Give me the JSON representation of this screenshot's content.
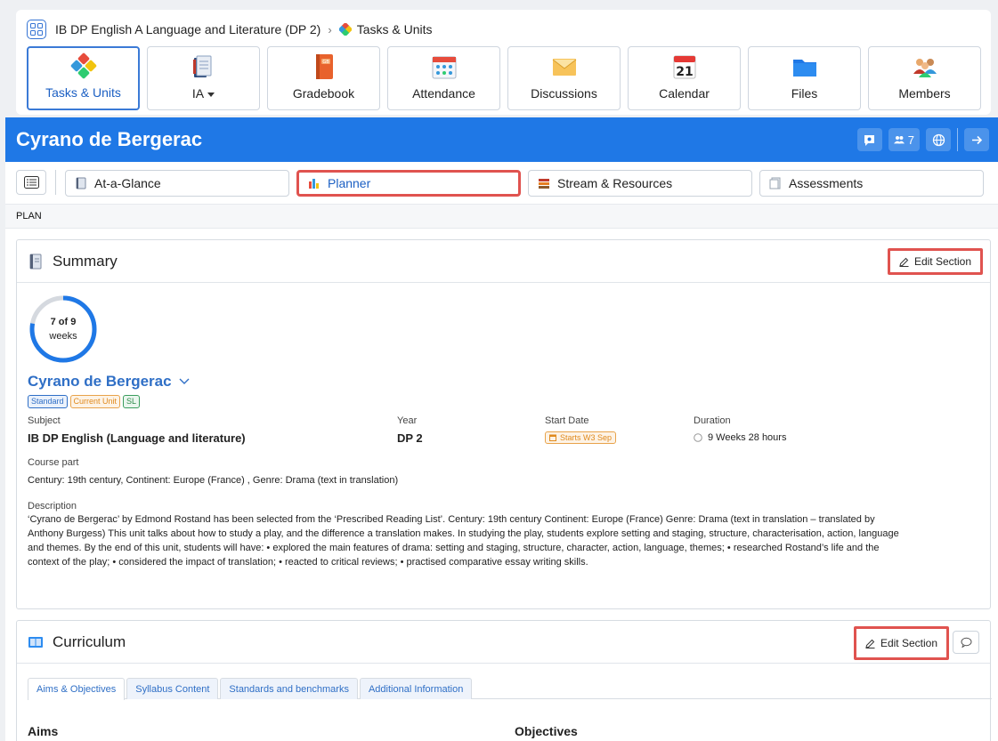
{
  "breadcrumb": {
    "course": "IB DP English A Language and Literature (DP 2)",
    "current": "Tasks & Units"
  },
  "nav_tabs": [
    {
      "label": "Tasks & Units",
      "icon": "puzzle-icon",
      "active": true
    },
    {
      "label": "IA",
      "icon": "books-icon",
      "dropdown": true
    },
    {
      "label": "Gradebook",
      "icon": "gradebook-icon"
    },
    {
      "label": "Attendance",
      "icon": "attendance-icon"
    },
    {
      "label": "Discussions",
      "icon": "envelope-icon"
    },
    {
      "label": "Calendar",
      "icon": "calendar-icon",
      "calendar_day": "21"
    },
    {
      "label": "Files",
      "icon": "folder-icon"
    },
    {
      "label": "Members",
      "icon": "members-icon"
    }
  ],
  "header": {
    "title": "Cyrano de Bergerac",
    "members_count": "7",
    "bg_color": "#1f78e6"
  },
  "sub_tabs": [
    {
      "label": "At-a-Glance",
      "icon": "notebook-icon"
    },
    {
      "label": "Planner",
      "icon": "chart-books-icon",
      "active": true
    },
    {
      "label": "Stream & Resources",
      "icon": "stack-icon"
    },
    {
      "label": "Assessments",
      "icon": "papers-icon"
    }
  ],
  "plan_label": "PLAN",
  "summary": {
    "title": "Summary",
    "edit_label": "Edit Section",
    "progress": {
      "current": 7,
      "total": 9,
      "text_main": "7 of 9",
      "text_unit": "weeks"
    },
    "unit_name": "Cyrano de Bergerac",
    "badges": [
      "Standard",
      "Current Unit",
      "SL"
    ],
    "subject_label": "Subject",
    "subject_value": "IB DP English (Language and literature)",
    "year_label": "Year",
    "year_value": "DP 2",
    "start_label": "Start Date",
    "start_value": "Starts W3 Sep",
    "duration_label": "Duration",
    "duration_value": "9 Weeks 28 hours",
    "course_part_label": "Course part",
    "course_part_value": "Century: 19th century, Continent: Europe (France) , Genre: Drama (text in translation)",
    "description_label": "Description",
    "description_value": "‘Cyrano de Bergerac’ by Edmond Rostand has been selected from the ‘Prescribed Reading List’. Century: 19th century Continent: Europe (France) Genre: Drama (text in translation – translated by Anthony Burgess) This unit talks about how to study a play, and the difference a translation makes. In studying the play, students explore setting and staging, structure, characterisation, action, language and themes. By the end of this unit, students will have: • explored the main features of drama: setting and staging, structure, character, action, language, themes; • researched Rostand’s life and the context of the play; • considered the impact of translation; • reacted to critical reviews; • practised comparative essay writing skills."
  },
  "curriculum": {
    "title": "Curriculum",
    "edit_label": "Edit Section",
    "tabs": [
      "Aims & Objectives",
      "Syllabus Content",
      "Standards and benchmarks",
      "Additional Information"
    ],
    "aims_heading": "Aims",
    "objectives_heading": "Objectives"
  },
  "colors": {
    "accent": "#1f78e6",
    "link": "#2f6fc6",
    "highlight": "#e0534f",
    "warning": "#e08a1e",
    "success": "#2e8b4b"
  }
}
